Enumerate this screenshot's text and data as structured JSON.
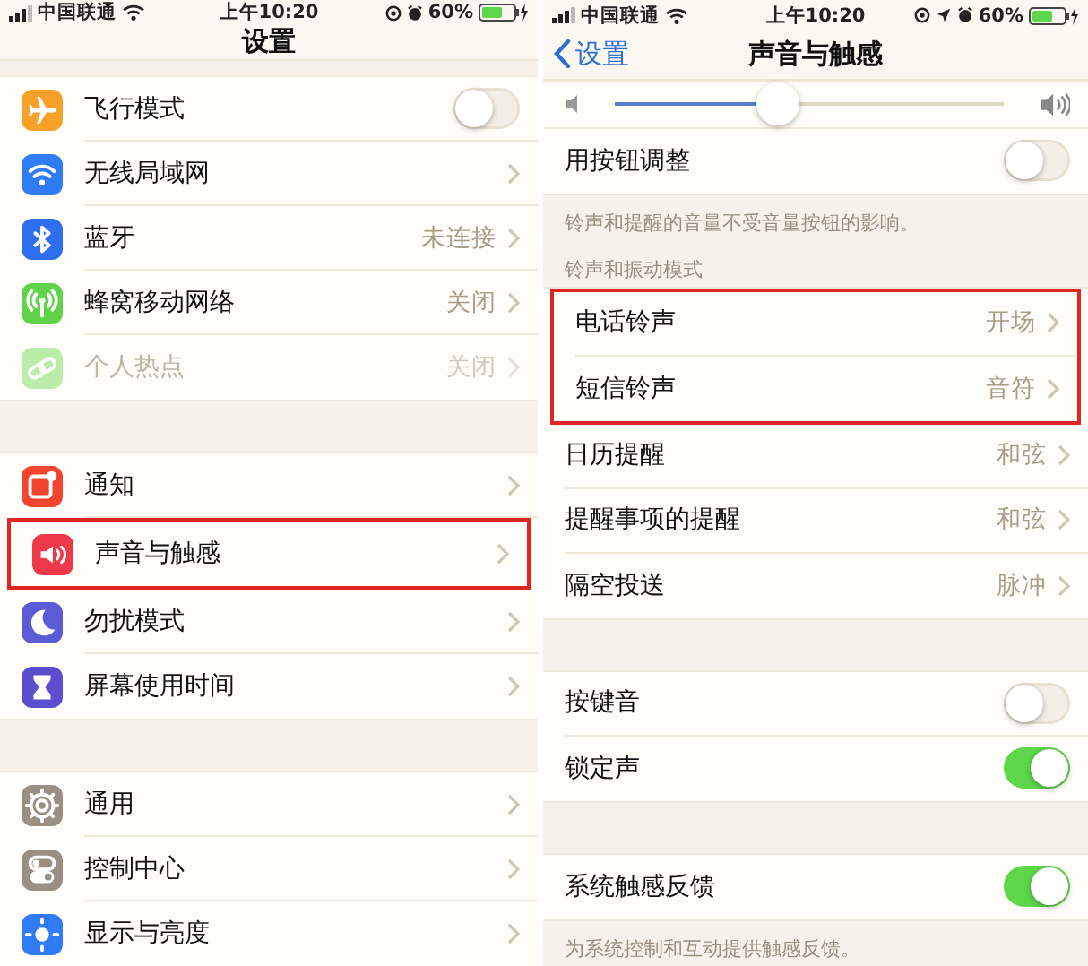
{
  "screens": [
    {
      "status_bar": {
        "carrier": "中国联通",
        "time": "上午10:20",
        "battery": "60%",
        "location_services": false
      },
      "nav": {
        "title": "设置"
      },
      "sections": [
        {
          "kind": "group",
          "rows": [
            {
              "kind": "toggle",
              "label": "飞行模式",
              "on": false,
              "color": "#f7a12b",
              "disabled": false,
              "highlighted": false
            },
            {
              "kind": "link",
              "label": "无线局域网",
              "color": "#2f7cf6",
              "disabled": false,
              "highlighted": false
            },
            {
              "kind": "link",
              "label": "蓝牙",
              "value": "未连接",
              "color": "#2f6ef0",
              "disabled": false,
              "highlighted": false
            },
            {
              "kind": "link",
              "label": "蜂窝移动网络",
              "value": "关闭",
              "color": "#5fd34a",
              "disabled": false,
              "highlighted": false
            },
            {
              "kind": "link",
              "label": "个人热点",
              "value": "关闭",
              "color": "#bcecaa",
              "disabled": true,
              "highlighted": false
            }
          ]
        },
        {
          "kind": "group",
          "rows": [
            {
              "kind": "link",
              "label": "通知",
              "color": "#f1452f",
              "disabled": false,
              "highlighted": false
            },
            {
              "kind": "link",
              "label": "声音与触感",
              "color": "#f0384b",
              "disabled": false,
              "highlighted": true
            },
            {
              "kind": "link",
              "label": "勿扰模式",
              "color": "#5b5bd6",
              "disabled": false,
              "highlighted": false
            },
            {
              "kind": "link",
              "label": "屏幕使用时间",
              "color": "#5b4fcf",
              "disabled": false,
              "highlighted": false
            }
          ]
        },
        {
          "kind": "group",
          "rows": [
            {
              "kind": "link",
              "label": "通用",
              "color": "#9a8f83",
              "disabled": false,
              "highlighted": false
            },
            {
              "kind": "link",
              "label": "控制中心",
              "color": "#9a8f83",
              "disabled": false,
              "highlighted": false
            },
            {
              "kind": "link",
              "label": "显示与亮度",
              "color": "#2f7cf6",
              "disabled": false,
              "highlighted": false
            }
          ]
        }
      ]
    },
    {
      "status_bar": {
        "carrier": "中国联通",
        "time": "上午10:20",
        "battery": "60%",
        "location_services": true
      },
      "nav": {
        "title": "声音与触感",
        "back": "设置"
      },
      "sections": [
        {
          "kind": "group",
          "rows": [
            {
              "kind": "slider",
              "level": 0.42,
              "disabled": false,
              "highlighted": false
            },
            {
              "kind": "toggle",
              "label": "用按钮调整",
              "on": false,
              "disabled": false,
              "highlighted": false
            }
          ]
        },
        {
          "kind": "footer",
          "text": "铃声和提醒的音量不受音量按钮的影响。"
        },
        {
          "kind": "header",
          "text": "铃声和振动模式"
        },
        {
          "kind": "group",
          "rows": [
            {
              "kind": "link",
              "label": "电话铃声",
              "value": "开场",
              "disabled": false,
              "highlighted": true
            },
            {
              "kind": "link",
              "label": "短信铃声",
              "value": "音符",
              "disabled": false,
              "highlighted": true
            },
            {
              "kind": "link",
              "label": "日历提醒",
              "value": "和弦",
              "disabled": false,
              "highlighted": false
            },
            {
              "kind": "link",
              "label": "提醒事项的提醒",
              "value": "和弦",
              "disabled": false,
              "highlighted": false
            },
            {
              "kind": "link",
              "label": "隔空投送",
              "value": "脉冲",
              "disabled": false,
              "highlighted": false
            }
          ]
        },
        {
          "kind": "group",
          "rows": [
            {
              "kind": "toggle",
              "label": "按键音",
              "on": false,
              "disabled": false,
              "highlighted": false
            },
            {
              "kind": "toggle",
              "label": "锁定声",
              "on": true,
              "disabled": false,
              "highlighted": false
            }
          ]
        },
        {
          "kind": "group",
          "rows": [
            {
              "kind": "toggle",
              "label": "系统触感反馈",
              "on": true,
              "disabled": false,
              "highlighted": false
            }
          ]
        },
        {
          "kind": "footer",
          "text": "为系统控制和互动提供触感反馈。"
        }
      ]
    }
  ]
}
